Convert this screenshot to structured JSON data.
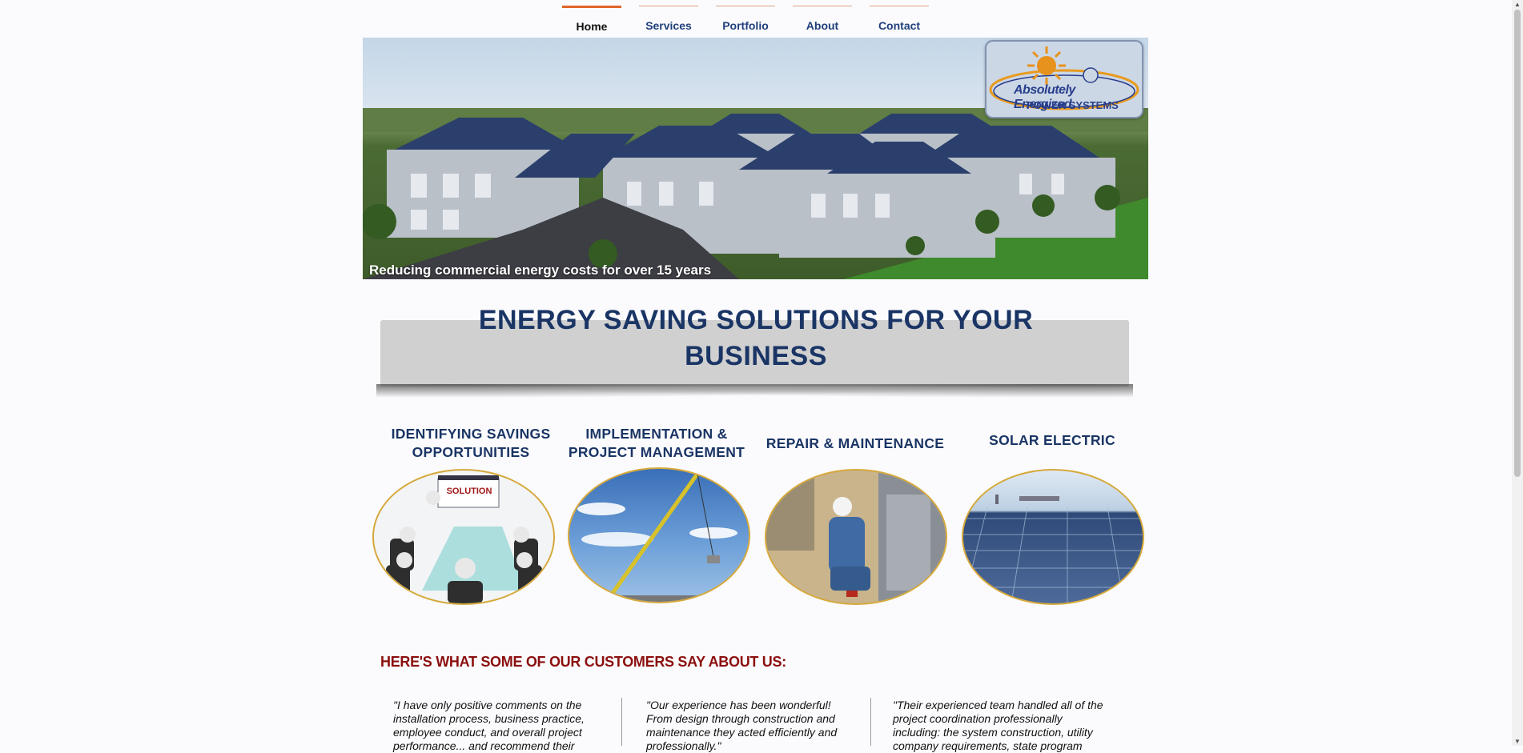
{
  "nav": {
    "items": [
      {
        "label": "Home",
        "active": true
      },
      {
        "label": "Services",
        "active": false
      },
      {
        "label": "Portfolio",
        "active": false
      },
      {
        "label": "About",
        "active": false
      },
      {
        "label": "Contact",
        "active": false
      }
    ]
  },
  "hero": {
    "caption": "Reducing commercial energy costs for over 15 years",
    "logo": {
      "line1": "Absolutely Energized",
      "line2": "POWER SYSTEMS"
    }
  },
  "headline": "ENERGY SAVING SOLUTIONS FOR YOUR BUSINESS",
  "services": [
    {
      "title_line1": "IDENTIFYING SAVINGS",
      "title_line2": "OPPORTUNITIES",
      "image_label": "SOLUTION"
    },
    {
      "title_line1": "IMPLEMENTATION &",
      "title_line2": "PROJECT MANAGEMENT"
    },
    {
      "title_line1": "REPAIR & MAINTENANCE",
      "title_line2": ""
    },
    {
      "title_line1": "SOLAR ELECTRIC",
      "title_line2": ""
    }
  ],
  "testimonials": {
    "heading": "HERE'S WHAT SOME OF OUR CUSTOMERS SAY ABOUT US:",
    "quotes": [
      {
        "lines": [
          "\"I have only positive comments on the",
          "installation process, business practice,",
          "employee conduct, and overall project",
          "performance... and recommend their"
        ]
      },
      {
        "lines": [
          "\"Our experience has been wonderful!",
          " From design through construction and",
          "maintenance they acted efficiently and",
          "professionally.\""
        ]
      },
      {
        "lines": [
          "\"Their experienced team handled all of the",
          "project coordination professionally",
          "including: the system construction, utility",
          "company requirements, state program"
        ]
      }
    ]
  },
  "colors": {
    "accent": "#e0662a",
    "nav_text": "#1f3f7a",
    "headline": "#1a3565",
    "testimonial_heading": "#8b0f0f",
    "circle_border": "#d6a93c"
  }
}
